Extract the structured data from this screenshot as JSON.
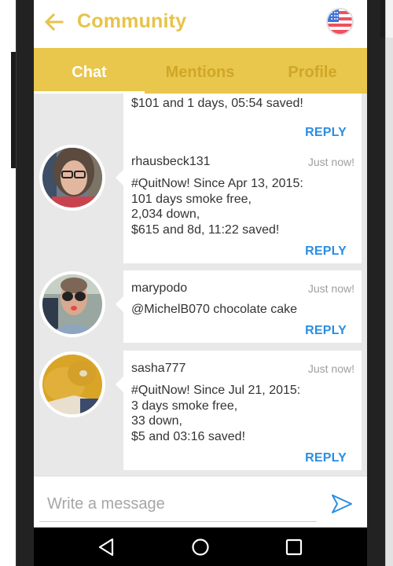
{
  "app": {
    "title": "Community",
    "back_icon": "arrow-left-icon",
    "flag_icon": "us-flag-icon"
  },
  "colors": {
    "accent": "#e9c64c",
    "title": "#e7c34a",
    "tab_inactive": "#cfa728",
    "link": "#2a8ee2",
    "background": "#e8e8e8"
  },
  "tabs": [
    {
      "label": "Chat",
      "active": true
    },
    {
      "label": "Mentions",
      "active": false
    },
    {
      "label": "Profile",
      "active": false
    }
  ],
  "messages": [
    {
      "username": "",
      "time": "",
      "body": "$101 and 1 days, 05:54 saved!",
      "reply_label": "REPLY",
      "partial": true
    },
    {
      "username": "rhausbeck131",
      "time": "Just now!",
      "body": "#QuitNow! Since Apr 13, 2015:\n101 days smoke free,\n2,034 down,\n$615 and 8d, 11:22 saved!",
      "reply_label": "REPLY"
    },
    {
      "username": "marypodo",
      "time": "Just now!",
      "body": "@MichelB070 chocolate cake",
      "reply_label": "REPLY"
    },
    {
      "username": "sasha777",
      "time": "Just now!",
      "body": "#QuitNow! Since Jul 21, 2015:\n3 days smoke free,\n33 down,\n$5 and 03:16 saved!",
      "reply_label": "REPLY"
    }
  ],
  "composer": {
    "placeholder": "Write a message",
    "value": "",
    "send_icon": "send-icon"
  },
  "navbar": {
    "back": "nav-back-icon",
    "home": "nav-home-icon",
    "recent": "nav-recent-apps-icon"
  }
}
